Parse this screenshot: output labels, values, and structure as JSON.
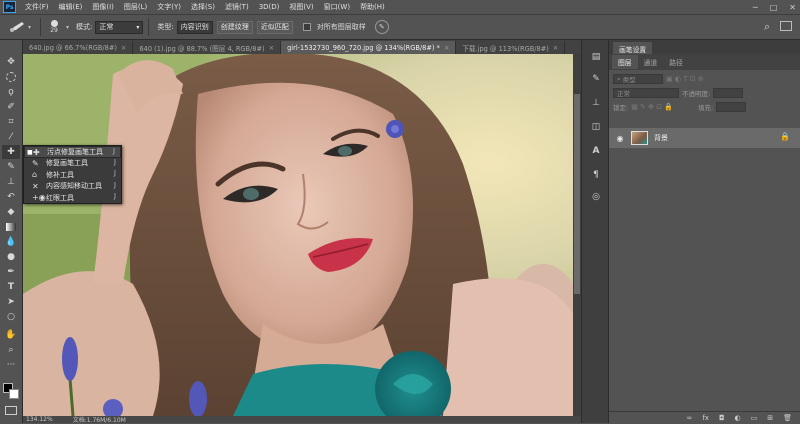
{
  "menubar": {
    "logo": "Ps",
    "items": [
      "文件(F)",
      "编辑(E)",
      "图像(I)",
      "图层(L)",
      "文字(Y)",
      "选择(S)",
      "滤镜(T)",
      "3D(D)",
      "视图(V)",
      "窗口(W)",
      "帮助(H)"
    ],
    "window_controls": [
      "─",
      "□",
      "✕"
    ]
  },
  "options": {
    "brush_size": "29",
    "mode_label": "模式:",
    "mode_value": "正常",
    "type_label": "类型:",
    "type_buttons": [
      "内容识别",
      "创建纹理",
      "近似匹配"
    ],
    "sample_all_label": "对所有图层取样"
  },
  "tabs": [
    {
      "label": "640.jpg @ 66.7%(RGB/8#)",
      "close": "×"
    },
    {
      "label": "640 (1).jpg @ 88.7% (图层 4, RGB/8#)",
      "close": "×"
    },
    {
      "label": "girl-1532730_960_720.jpg @ 134%(RGB/8#) *",
      "close": "×"
    },
    {
      "label": "下载.jpg @ 113%(RGB/8#)",
      "close": "×"
    }
  ],
  "flyout": [
    {
      "label": "污点修复画笔工具",
      "key": "J",
      "icon": "spot-healing-icon"
    },
    {
      "label": "修复画笔工具",
      "key": "J",
      "icon": "healing-brush-icon"
    },
    {
      "label": "修补工具",
      "key": "J",
      "icon": "patch-icon"
    },
    {
      "label": "内容感知移动工具",
      "key": "J",
      "icon": "content-aware-move-icon"
    },
    {
      "label": "红眼工具",
      "key": "J",
      "icon": "red-eye-icon"
    }
  ],
  "status": {
    "zoom": "134.12%",
    "doc": "文档:1.76M/6.10M"
  },
  "panel": {
    "header_tab": "画笔设置",
    "tabs": [
      "图层",
      "通道",
      "路径"
    ],
    "kind_placeholder": "类型",
    "blend_mode": "正常",
    "opacity_label": "不透明度:",
    "lock_label": "锁定:",
    "fill_label": "填充:",
    "layer_name": "背景"
  }
}
